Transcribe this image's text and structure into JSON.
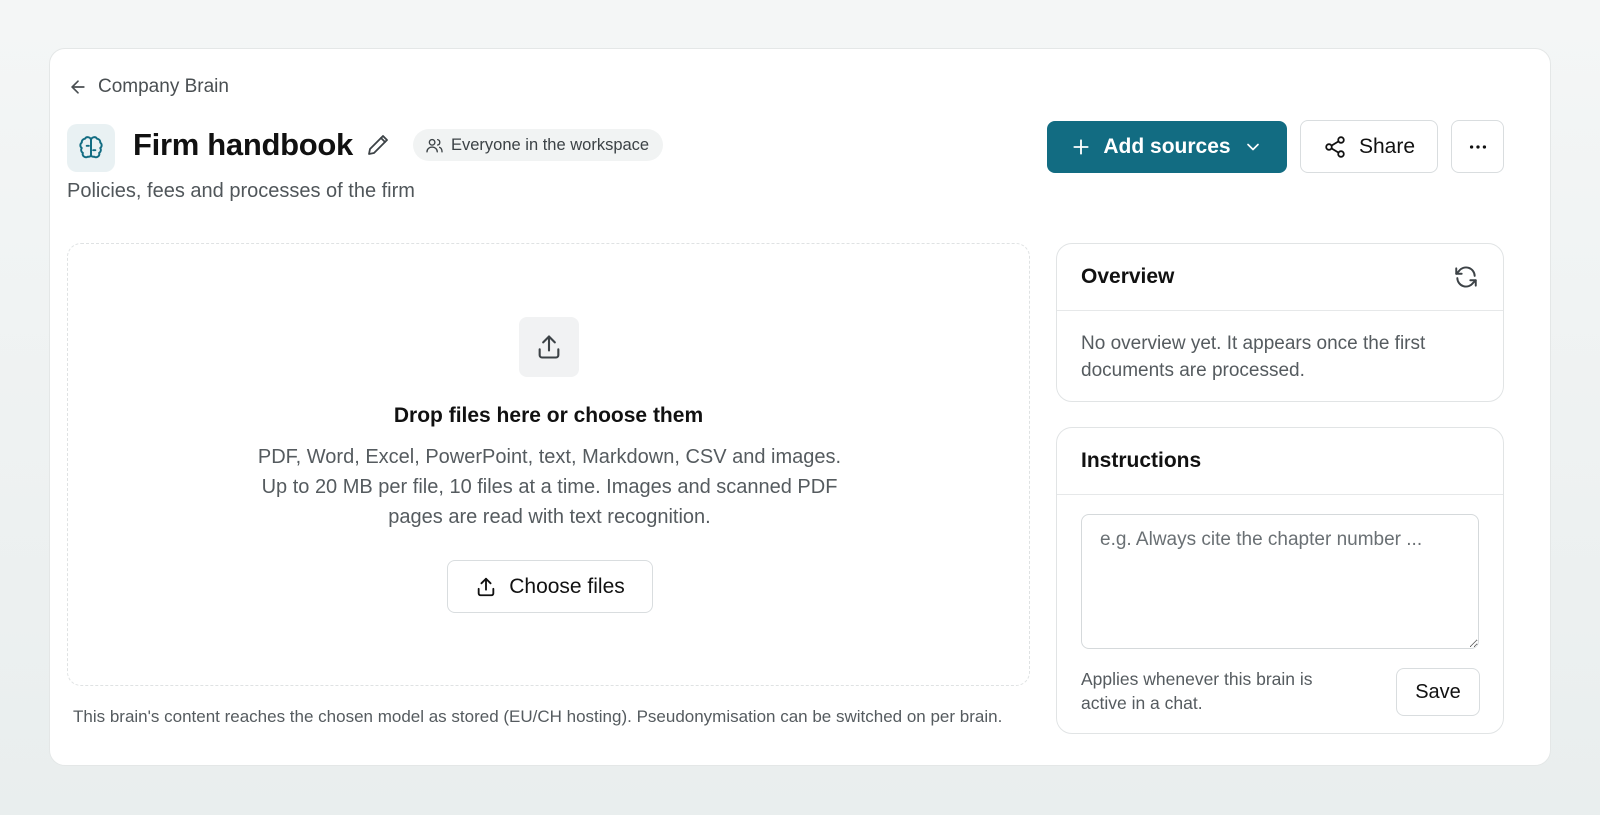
{
  "breadcrumb": {
    "label": "Company Brain",
    "icon": "arrow-left-icon"
  },
  "header": {
    "title": "Firm handbook",
    "subtitle": "Policies, fees and processes of the firm",
    "visibility": "Everyone in the workspace",
    "brain_icon": "brain-icon",
    "add_sources_label": "Add sources",
    "share_label": "Share",
    "accent_color": "#126c82"
  },
  "dropzone": {
    "title": "Drop files here or choose them",
    "description": "PDF, Word, Excel, PowerPoint, text, Markdown, CSV and images. Up to 20 MB per file, 10 files at a time. Images and scanned PDF pages are read with text recognition.",
    "choose_label": "Choose files"
  },
  "footer_note": "This brain's content reaches the chosen model as stored (EU/CH hosting). Pseudonymisation can be switched on per brain.",
  "overview": {
    "title": "Overview",
    "text": "No overview yet. It appears once the first documents are processed."
  },
  "instructions": {
    "title": "Instructions",
    "placeholder": "e.g. Always cite the chapter number ...",
    "value": "",
    "apply_note": "Applies whenever this brain is active in a chat.",
    "save_label": "Save"
  }
}
